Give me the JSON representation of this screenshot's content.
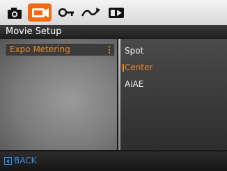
{
  "tabs": [
    {
      "icon": "camera-icon"
    },
    {
      "icon": "movie-camera-icon",
      "active": true
    },
    {
      "icon": "key-icon"
    },
    {
      "icon": "curve-icon"
    },
    {
      "icon": "playback-icon"
    }
  ],
  "header": {
    "title": "Movie Setup"
  },
  "menu": {
    "selected_label": "Expo Metering"
  },
  "options": [
    {
      "label": "Spot"
    },
    {
      "label": "Center",
      "selected": true
    },
    {
      "label": "AiAE"
    }
  ],
  "footer": {
    "back_label": "BACK"
  },
  "colors": {
    "accent": "#f08a1e",
    "tab_active": "#f26a12",
    "back": "#3d8be0"
  }
}
